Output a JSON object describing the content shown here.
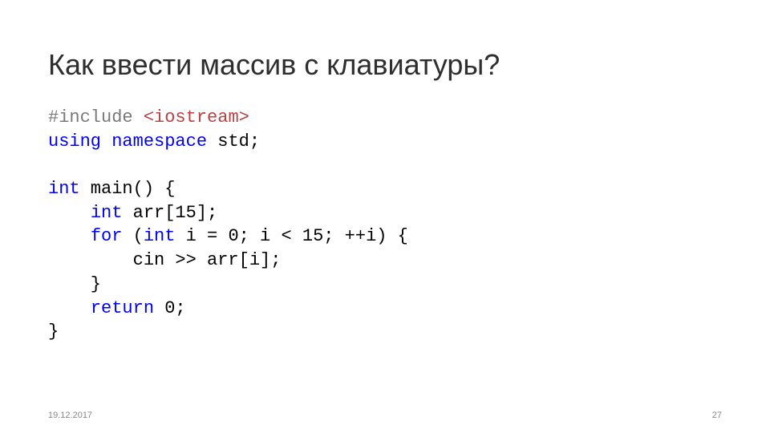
{
  "title": "Как ввести массив с клавиатуры?",
  "code": {
    "l1a": "#include",
    "l1b": " <iostream>",
    "l2a": "using",
    "l2b": " ",
    "l2c": "namespace",
    "l2d": " std;",
    "l3a": "int",
    "l3b": " main() {",
    "l4a": "    ",
    "l4b": "int",
    "l4c": " arr[15];",
    "l5a": "    ",
    "l5b": "for",
    "l5c": " (",
    "l5d": "int",
    "l5e": " i = 0; i < 15; ++i) {",
    "l6": "        cin >> arr[i];",
    "l7": "    }",
    "l8a": "    ",
    "l8b": "return",
    "l8c": " 0;",
    "l9": "}"
  },
  "footer": {
    "date": "19.12.2017",
    "page": "27"
  }
}
